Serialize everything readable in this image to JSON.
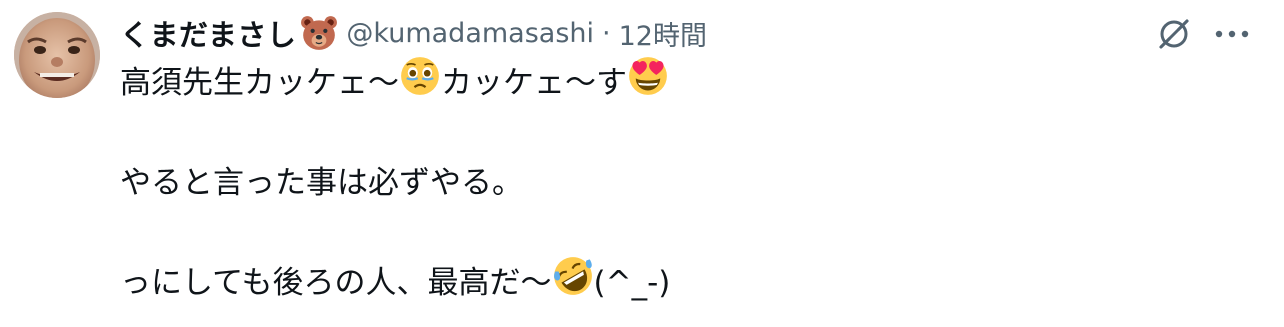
{
  "post": {
    "display_name": "くまだまさし",
    "name_emoji": "bear-face-emoji",
    "handle": "@kumadamasashi",
    "separator": "·",
    "timestamp": "12時間",
    "body": {
      "line1_a": "高須先生カッケェ〜",
      "line1_emoji1": "face-holding-back-tears-emoji",
      "line1_b": "カッケェ〜す",
      "line1_emoji2": "heart-eyes-emoji",
      "line2": "やると言った事は必ずやる。",
      "line3_a": "っにしても後ろの人、最高だ〜",
      "line3_emoji": "rolling-on-floor-laughing-emoji",
      "line3_b": "(^_-)"
    }
  },
  "colors": {
    "text": "#0f1419",
    "secondary": "#536471",
    "emoji_yellow": "#ffcc4d",
    "emoji_heart": "#f4245e",
    "emoji_tear": "#5dadec",
    "bear_brown": "#c1694f"
  },
  "icons": {
    "grok": "grok-icon",
    "more": "more-icon"
  }
}
